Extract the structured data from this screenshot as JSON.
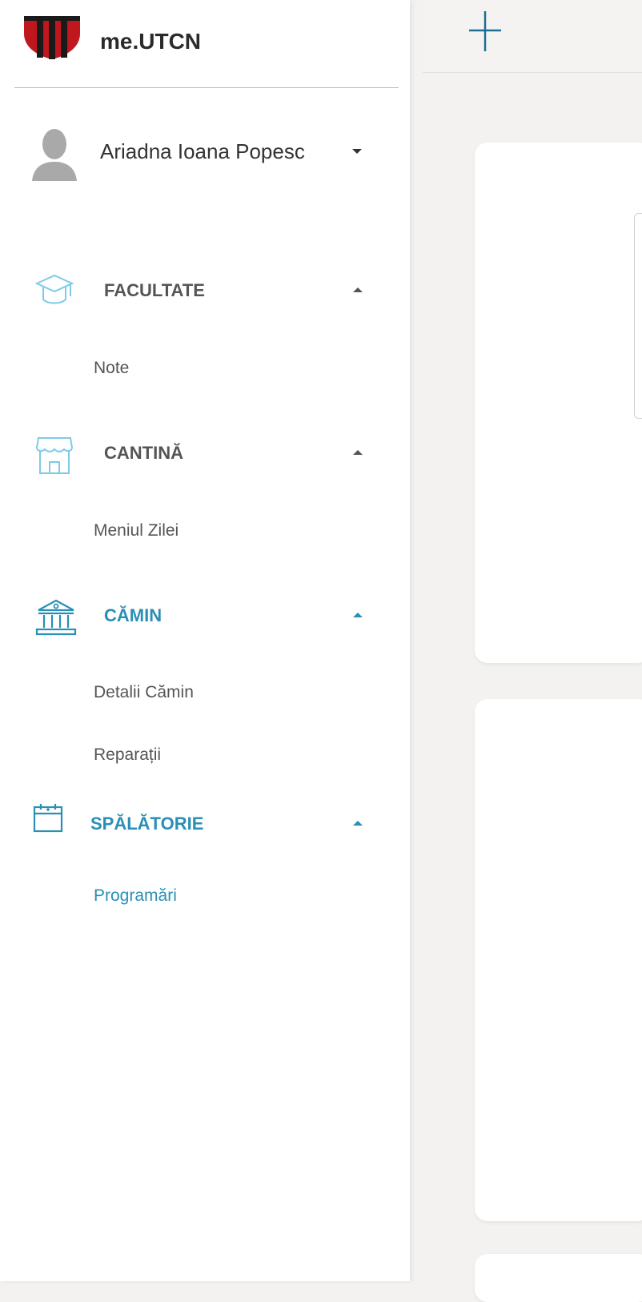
{
  "brand": {
    "name": "me.UTCN",
    "icon": "utcn-shield-logo"
  },
  "user": {
    "name": "Ariadna Ioana Popesc",
    "icon": "user-avatar-icon"
  },
  "nav": {
    "facultate": {
      "label": "FACULTATE",
      "icon": "graduation-cap-icon",
      "items": [
        {
          "label": "Note"
        }
      ]
    },
    "cantina": {
      "label": "CANTINĂ",
      "icon": "storefront-icon",
      "items": [
        {
          "label": "Meniul Zilei"
        }
      ]
    },
    "camin": {
      "label": "CĂMIN",
      "icon": "building-icon",
      "items": [
        {
          "label": "Detalii Cămin"
        },
        {
          "label": "Reparații"
        }
      ]
    },
    "spalatorie": {
      "label": "SPĂLĂTORIE",
      "icon": "calendar-icon",
      "items": [
        {
          "label": "Programări"
        }
      ]
    }
  },
  "colors": {
    "accent": "#2a8fb6",
    "brand_red": "#c0161e",
    "text": "#555555"
  }
}
